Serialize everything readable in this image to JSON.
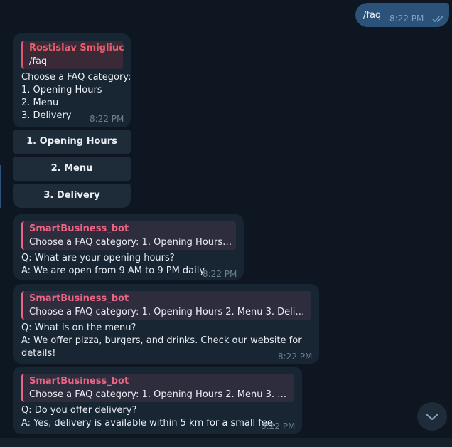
{
  "outgoing": {
    "text": "/faq",
    "time": "8:22 PM",
    "status_icon": "double-check-icon"
  },
  "faq_prompt": {
    "reply_author": "Rostislav Smigliuc",
    "reply_text": "/faq",
    "lines": [
      "Choose a FAQ category:",
      "1. Opening Hours",
      "2. Menu",
      "3. Delivery"
    ],
    "time": "8:22 PM"
  },
  "keyboard": {
    "buttons": [
      "1. Opening Hours",
      "2. Menu",
      "3. Delivery"
    ]
  },
  "answers": [
    {
      "reply_author": "SmartBusiness_bot",
      "reply_text": "Choose a FAQ category: 1. Opening Hours 2. ...",
      "lines": [
        "Q: What are your opening hours?",
        "A: We are open from 9 AM to 9 PM daily."
      ],
      "time": "8:22 PM"
    },
    {
      "reply_author": "SmartBusiness_bot",
      "reply_text": "Choose a FAQ category: 1. Opening Hours 2. Menu 3. Delivery",
      "lines": [
        "Q: What is on the menu?",
        "A: We offer pizza, burgers, and drinks. Check our website for",
        "details!"
      ],
      "time": "8:22 PM"
    },
    {
      "reply_author": "SmartBusiness_bot",
      "reply_text": "Choose a FAQ category: 1. Opening Hours 2. Menu 3. Deliv...",
      "lines": [
        "Q: Do you offer delivery?",
        "A: Yes, delivery is available within 5 km for a small fee."
      ],
      "time": "8:22 PM"
    }
  ],
  "scroll_button_icon": "chevron-down-icon",
  "colors": {
    "background": "#0e1621",
    "outgoing": "#2b5278",
    "incoming": "#182533",
    "accent": "#e96584"
  }
}
